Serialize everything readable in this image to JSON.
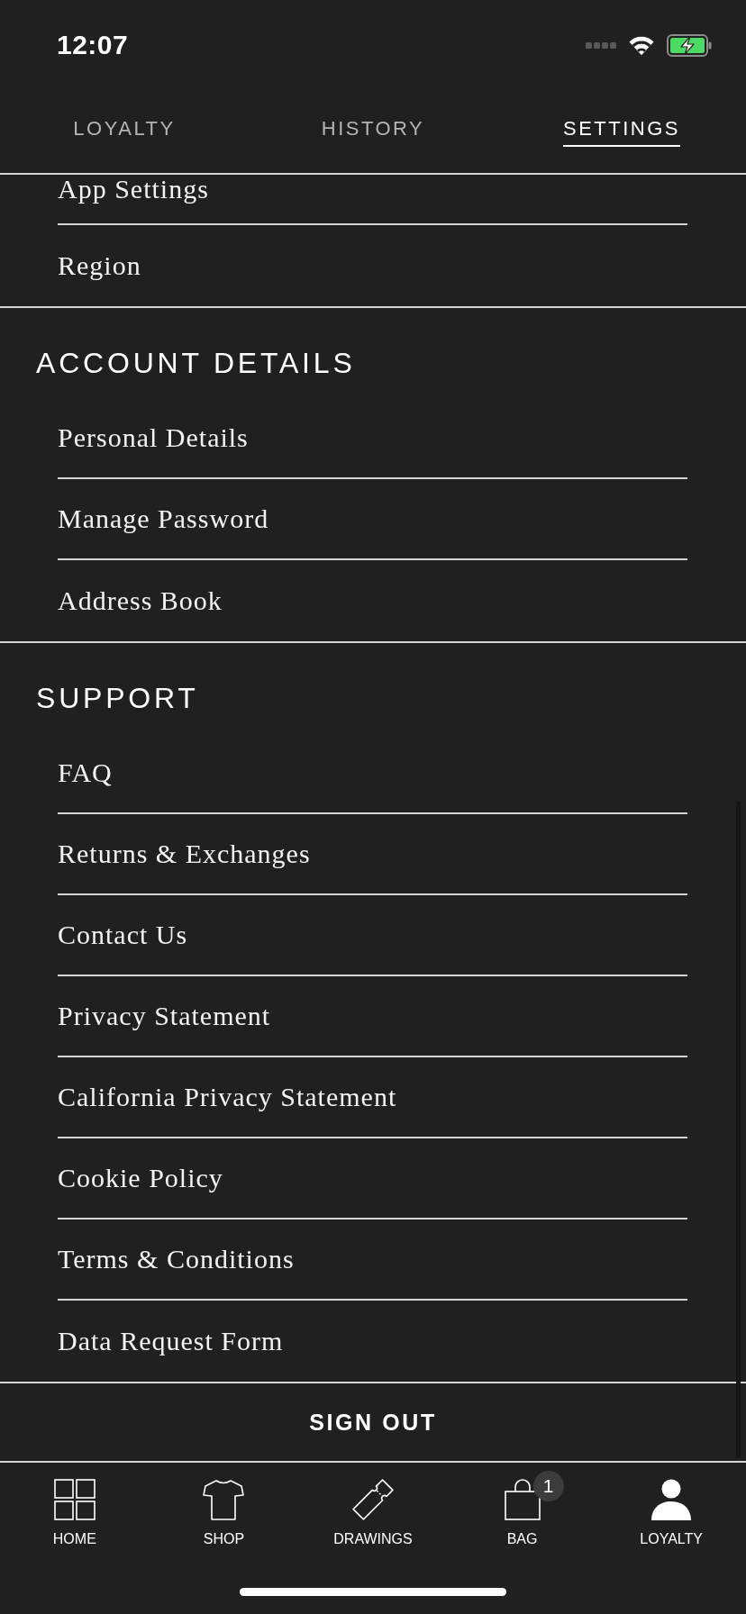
{
  "status_bar": {
    "time": "12:07"
  },
  "tabs": [
    {
      "label": "LOYALTY",
      "selected": false
    },
    {
      "label": "HISTORY",
      "selected": false
    },
    {
      "label": "SETTINGS",
      "selected": true
    }
  ],
  "sections": [
    {
      "items": [
        "App Settings",
        "Region"
      ]
    },
    {
      "title": "ACCOUNT DETAILS",
      "items": [
        "Personal Details",
        "Manage Password",
        "Address Book"
      ]
    },
    {
      "title": "SUPPORT",
      "items": [
        "FAQ",
        "Returns & Exchanges",
        "Contact Us",
        "Privacy Statement",
        "California Privacy Statement",
        "Cookie Policy",
        "Terms & Conditions",
        "Data Request Form"
      ]
    }
  ],
  "sign_out": {
    "label": "SIGN OUT"
  },
  "bottom_nav": [
    {
      "kind": "home",
      "label": "HOME",
      "selected": false
    },
    {
      "kind": "shop",
      "label": "SHOP",
      "selected": false
    },
    {
      "kind": "drawings",
      "label": "DRAWINGS",
      "selected": false
    },
    {
      "kind": "bag",
      "label": "BAG",
      "badge": "1",
      "selected": false
    },
    {
      "kind": "loyalty",
      "label": "LOYALTY",
      "selected": true
    }
  ]
}
